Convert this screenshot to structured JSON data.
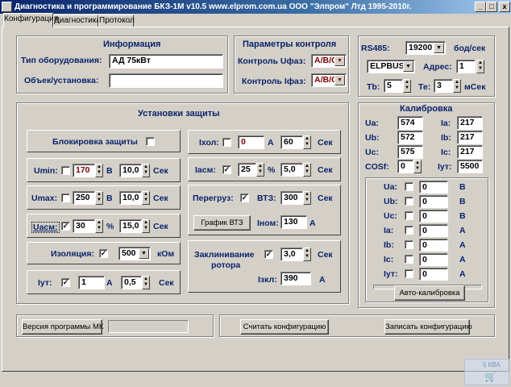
{
  "window": {
    "title": "Диагностика и программирование БКЗ-1М     v10.5                    www.elprom.com.ua               ООО \"Элпром\" Лтд   1995-2010г.",
    "min": "_",
    "max": "□",
    "close": "x"
  },
  "tabs": [
    "Конфигурация",
    "Диагностика",
    "Протокол"
  ],
  "info": {
    "title": "Информация",
    "type_label": "Тип оборудования:",
    "type_value": "АД 75кВт",
    "obj_label": "Объек/установка:",
    "obj_value": ""
  },
  "params": {
    "title": "Параметры контроля",
    "uf_label": "Контроль Uфаз:",
    "uf_value": "А/В/С",
    "if_label": "Контроль Iфаз:",
    "if_value": "А/В/С"
  },
  "rs485": {
    "label": "RS485:",
    "baud": "19200",
    "baud_unit": "бод/сек",
    "protocol": "ELPBUS",
    "addr_label": "Адрес:",
    "addr": "1",
    "tb_label": "Тb:",
    "tb": "5",
    "te_label": "Те:",
    "te": "3",
    "te_unit": "мСек"
  },
  "protect": {
    "title": "Установки защиты",
    "block_label": "Блокировка защиты",
    "umin_label": "Umin:",
    "umin": "170",
    "umin_unit": "В",
    "umin_t": "10,0",
    "umin_t_unit": "Сек",
    "umax_label": "Umax:",
    "umax": "250",
    "umax_unit": "В",
    "umax_t": "10,0",
    "umax_t_unit": "Сек",
    "uasm_label": "Uасм:",
    "uasm": "30",
    "uasm_unit": "%",
    "uasm_t": "15,0",
    "uasm_t_unit": "Сек",
    "iso_label": "Изоляция:",
    "iso": "500",
    "iso_unit": "кОм",
    "iut_label": "Iут:",
    "iut": "1",
    "iut_unit": "А",
    "iut_t": "0,5",
    "iut_t_unit": "Сек",
    "ixol_label": "Iхол:",
    "ixol": "0",
    "ixol_unit": "А",
    "ixol_t": "60",
    "ixol_t_unit": "Сек",
    "iasm_label": "Iасм:",
    "iasm": "25",
    "iasm_unit": "%",
    "iasm_t": "5,0",
    "iasm_t_unit": "Сек",
    "overload_label": "Перегруз:",
    "vtz_label": "ВТЗ:",
    "vtz": "300",
    "vtz_unit": "Сек",
    "vtz_btn": "График ВТЗ",
    "inom_label": "Iном:",
    "inom": "130",
    "inom_unit": "А",
    "rotor_label_1": "Заклинивание",
    "rotor_label_2": "ротора",
    "rotor_t": "3,0",
    "rotor_t_unit": "Сек",
    "izkl_label": "Iзкл:",
    "izkl": "390",
    "izkl_unit": "А"
  },
  "calib": {
    "title": "Калибровка",
    "rows": [
      {
        "l1": "Ua:",
        "v1": "574",
        "l2": "Ia:",
        "v2": "217"
      },
      {
        "l1": "Ub:",
        "v1": "572",
        "l2": "Ib:",
        "v2": "217"
      },
      {
        "l1": "Uc:",
        "v1": "575",
        "l2": "Ic:",
        "v2": "217"
      },
      {
        "l1": "COSf:",
        "v1": "0",
        "l2": "Iут:",
        "v2": "5500"
      }
    ],
    "auto_rows": [
      {
        "label": "Ua:",
        "value": "0",
        "unit": "В"
      },
      {
        "label": "Ub:",
        "value": "0",
        "unit": "В"
      },
      {
        "label": "Uc:",
        "value": "0",
        "unit": "В"
      },
      {
        "label": "Ia:",
        "value": "0",
        "unit": "А"
      },
      {
        "label": "Ib:",
        "value": "0",
        "unit": "А"
      },
      {
        "label": "Ic:",
        "value": "0",
        "unit": "А"
      },
      {
        "label": "Iут:",
        "value": "0",
        "unit": "А"
      }
    ],
    "auto_btn": "Авто-калибровка"
  },
  "bottom": {
    "version_btn": "Версия программы МК",
    "version_value": "",
    "read_btn": "Считать конфигурацию",
    "write_btn": "Записать конфигурацию"
  },
  "overlay": {
    "kb": "5 КВА"
  }
}
